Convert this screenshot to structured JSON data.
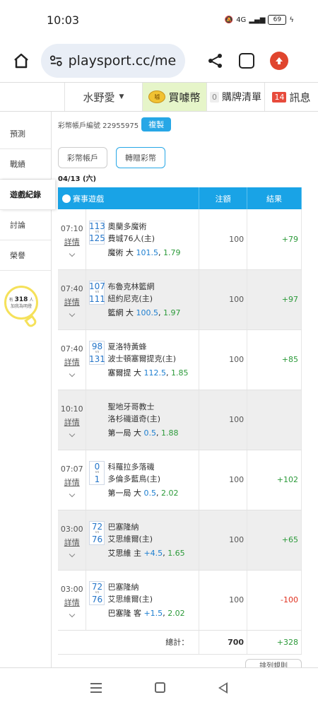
{
  "status_bar": {
    "time": "10:03",
    "network": "4G",
    "battery": "69"
  },
  "browser": {
    "url": "playsport.cc/men"
  },
  "topnav": {
    "user": "水野愛",
    "buy_label": "買噱幣",
    "coin_icon_text": "噱",
    "cart_label": "購牌清單",
    "cart_count": "0",
    "msg_label": "訊息",
    "msg_count": "14"
  },
  "sidebar": {
    "items": [
      {
        "label": "預測"
      },
      {
        "label": "戰績"
      },
      {
        "label": "遊戲紀錄",
        "active": true
      },
      {
        "label": "討論"
      },
      {
        "label": "榮譽"
      }
    ],
    "badge_prefix": "有",
    "badge_count": "318",
    "badge_unit": "人",
    "badge_text": "加我為明燈"
  },
  "account": {
    "label": "彩幣帳戶編號 22955975",
    "copy_label": "複製"
  },
  "subtabs": [
    "彩幣帳戶",
    "轉贈彩幣"
  ],
  "date": "04/13 (六)",
  "table": {
    "headers": {
      "game": "賽事遊戲",
      "amount": "注額",
      "result": "結果"
    },
    "detail_label": "詳情",
    "rows": [
      {
        "time": "07:10",
        "away_no": "113",
        "home_no": "125",
        "away": "奧蘭多魔術",
        "home": "費城76人(主)",
        "pick": "魔術 大",
        "line": "101.5",
        "odds": "1.79",
        "amount": "100",
        "result": "+79",
        "neg": false
      },
      {
        "time": "07:40",
        "away_no": "107",
        "home_no": "111",
        "away": "布魯克林籃網",
        "home": "紐約尼克(主)",
        "pick": "籃網 大",
        "line": "100.5",
        "odds": "1.97",
        "amount": "100",
        "result": "+97",
        "neg": false
      },
      {
        "time": "07:40",
        "away_no": "98",
        "home_no": "131",
        "away": "夏洛特黃蜂",
        "home": "波士頓塞爾提克(主)",
        "pick": "塞爾提 大",
        "line": "112.5",
        "odds": "1.85",
        "amount": "100",
        "result": "+85",
        "neg": false
      },
      {
        "time": "10:10",
        "away_no": "",
        "home_no": "",
        "away": "聖地牙哥教士",
        "home": "洛杉磯道奇(主)",
        "pick": "第一局 大",
        "line": "0.5",
        "odds": "1.88",
        "amount": "100",
        "result": "",
        "neg": false
      },
      {
        "time": "07:07",
        "away_no": "0",
        "home_no": "1",
        "away": "科羅拉多落磯",
        "home": "多倫多藍鳥(主)",
        "pick": "第一局 大",
        "line": "0.5",
        "odds": "2.02",
        "amount": "100",
        "result": "+102",
        "neg": false
      },
      {
        "time": "03:00",
        "away_no": "72",
        "home_no": "76",
        "away": "巴塞隆納",
        "home": "艾思維爾(主)",
        "pick": "艾思維 主",
        "line": "+4.5",
        "odds": "1.65",
        "amount": "100",
        "result": "+65",
        "neg": false
      },
      {
        "time": "03:00",
        "away_no": "72",
        "home_no": "76",
        "away": "巴塞隆納",
        "home": "艾思維爾(主)",
        "pick": "巴塞隆 客",
        "line": "+1.5",
        "odds": "2.02",
        "amount": "100",
        "result": "-100",
        "neg": true
      }
    ],
    "total_label": "總計：",
    "total_amount": "700",
    "total_result": "+328"
  },
  "sort_button": "排列規則"
}
